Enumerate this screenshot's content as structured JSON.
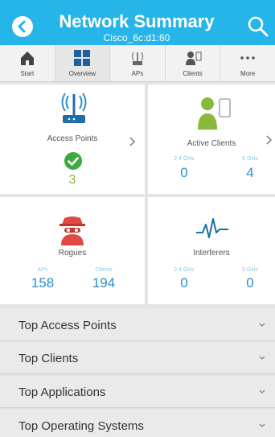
{
  "header": {
    "title": "Network Summary",
    "subtitle": "Cisco_6c:d1:60",
    "back_icon": "back-arrow-icon",
    "search_icon": "search-icon"
  },
  "tabs": [
    {
      "label": "Start",
      "icon": "home-icon"
    },
    {
      "label": "Overview",
      "icon": "grid-icon"
    },
    {
      "label": "APs",
      "icon": "access-point-icon"
    },
    {
      "label": "Clients",
      "icon": "clients-icon"
    },
    {
      "label": "More",
      "icon": "more-icon"
    }
  ],
  "tiles": {
    "access_points": {
      "label": "Access Points",
      "count": "3",
      "status_icon": "checkmark-icon"
    },
    "active_clients": {
      "label": "Active Clients",
      "band_24_label": "2.4 GHz",
      "band_5_label": "5 GHz",
      "band_24_value": "0",
      "band_5_value": "4"
    },
    "rogues": {
      "label": "Rogues",
      "aps_label": "APs",
      "clients_label": "Clients",
      "aps_value": "158",
      "clients_value": "194"
    },
    "interferers": {
      "label": "Interferers",
      "band_24_label": "2.4 GHz",
      "band_5_label": "5 GHz",
      "band_24_value": "0",
      "band_5_value": "0"
    }
  },
  "list": [
    {
      "label": "Top Access Points"
    },
    {
      "label": "Top Clients"
    },
    {
      "label": "Top Applications"
    },
    {
      "label": "Top Operating Systems"
    }
  ],
  "colors": {
    "header_bg": "#26b5e8",
    "accent_blue": "#2a8fcc",
    "success_green": "#3dab3d",
    "rogue_red": "#e04a45",
    "client_green": "#8ab83a"
  }
}
